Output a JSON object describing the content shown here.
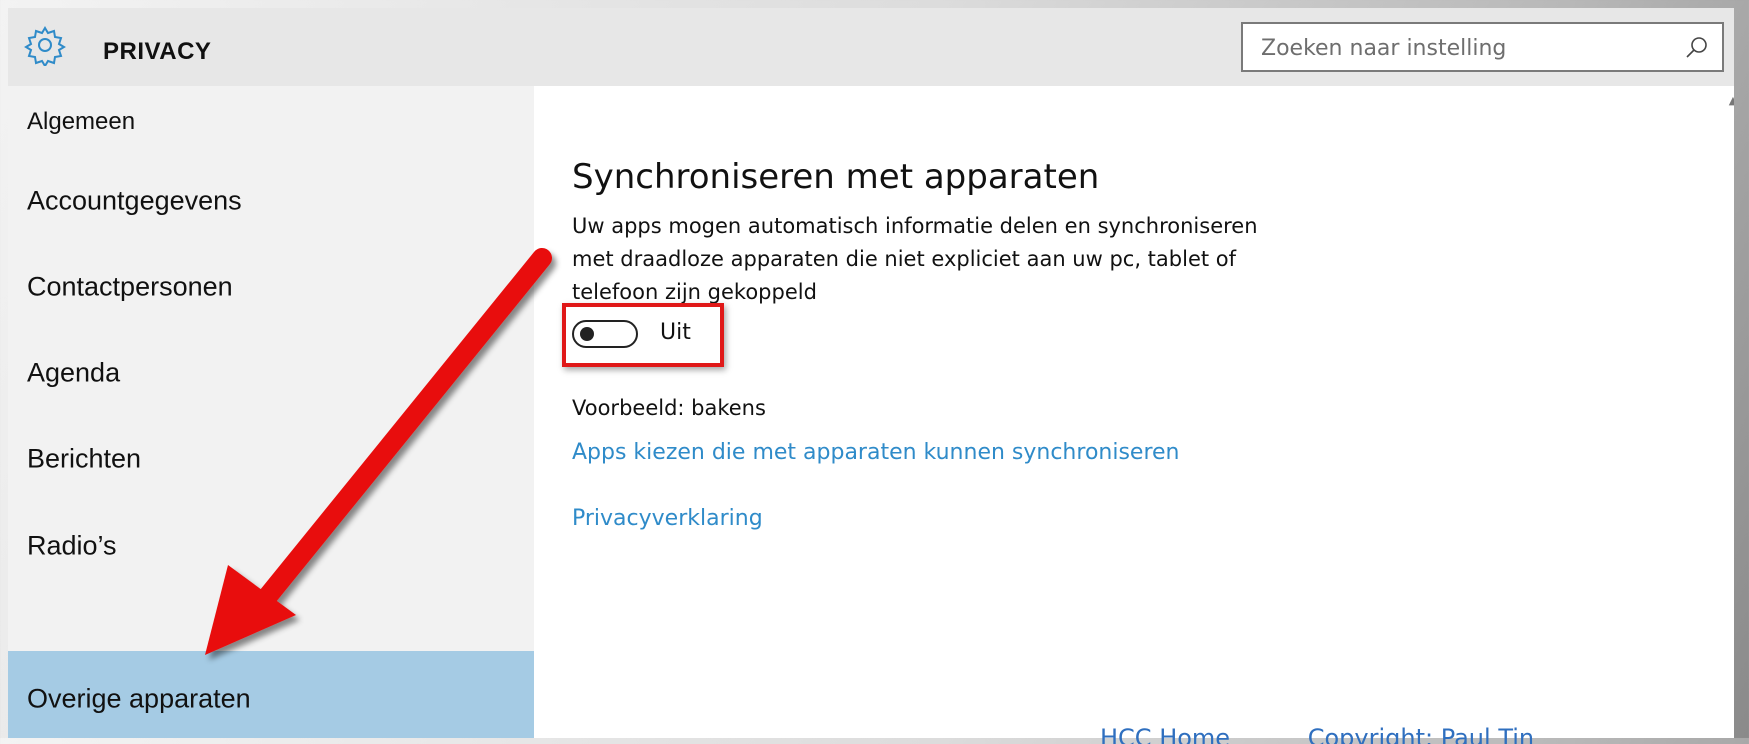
{
  "window": {
    "title": "PRIVACY",
    "search_placeholder": "Zoeken naar instelling"
  },
  "sidebar": {
    "items": [
      {
        "label": "Algemeen",
        "selected": false
      },
      {
        "label": "Accountgegevens",
        "selected": false
      },
      {
        "label": "Contactpersonen",
        "selected": false
      },
      {
        "label": "Agenda",
        "selected": false
      },
      {
        "label": "Berichten",
        "selected": false
      },
      {
        "label": "Radio’s",
        "selected": false
      },
      {
        "label": "Overige apparaten",
        "selected": true
      }
    ]
  },
  "main": {
    "heading": "Synchroniseren met apparaten",
    "description": "Uw apps mogen automatisch informatie delen en synchroniseren met draadloze apparaten die niet expliciet aan uw pc, tablet of telefoon zijn gekoppeld",
    "toggle": {
      "state": "off",
      "label": "Uit"
    },
    "example": "Voorbeeld: bakens",
    "links": [
      "Apps kiezen die met apparaten kunnen synchroniseren",
      "Privacyverklaring"
    ]
  },
  "footer": {
    "links": [
      "HCC Home",
      "Copyright: Paul Tin"
    ]
  },
  "icons": {
    "title": "gear-icon",
    "search": "search-icon",
    "annotation": "red-arrow"
  },
  "colors": {
    "accent": "#2f8bc9",
    "selected": "#a5cbe4",
    "highlight": "#e01818",
    "titlebar": "#e7e7e7",
    "sidebar": "#f2f2f2"
  }
}
